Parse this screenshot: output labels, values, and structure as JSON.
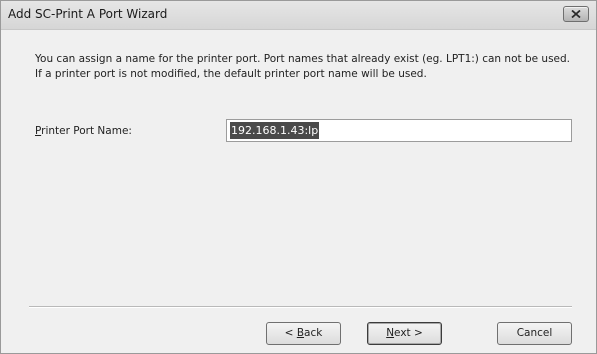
{
  "window": {
    "title": "Add SC-Print A Port Wizard"
  },
  "description": {
    "line1": "You can assign a name for the printer port. Port names that already exist (eg. LPT1:) can not be used.",
    "line2": "If a printer port is not modified, the default printer port name will be used."
  },
  "port_field": {
    "label_accel": "P",
    "label_rest": "rinter Port Name:",
    "value": "192.168.1.43:lp"
  },
  "buttons": {
    "back_prefix": "< ",
    "back_accel": "B",
    "back_rest": "ack",
    "next_accel": "N",
    "next_rest": "ext >",
    "cancel": "Cancel"
  },
  "icons": {
    "close": "close-icon"
  }
}
